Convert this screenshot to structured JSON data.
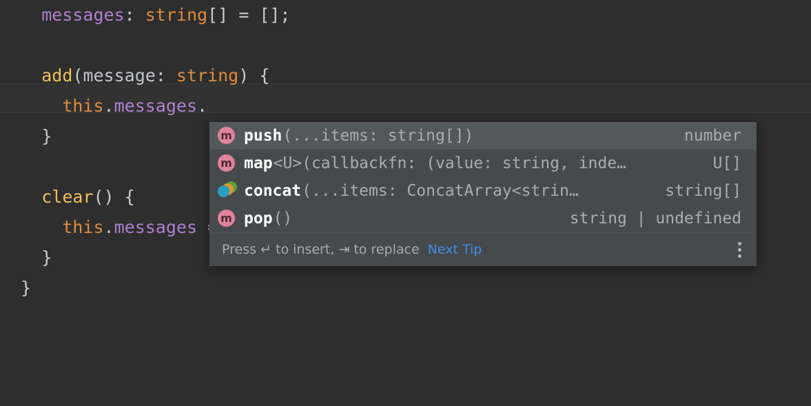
{
  "editor": {
    "background": "#2e2e2e",
    "current_line_highlight": "#323232",
    "lines": [
      {
        "indent": "    ",
        "tokens": [
          {
            "text": "messages",
            "kind": "property"
          },
          {
            "text": ": ",
            "kind": "punct"
          },
          {
            "text": "string",
            "kind": "type"
          },
          {
            "text": "[] = [];",
            "kind": "punct"
          }
        ]
      },
      {
        "indent": "",
        "tokens": []
      },
      {
        "indent": "    ",
        "tokens": [
          {
            "text": "add",
            "kind": "func"
          },
          {
            "text": "(",
            "kind": "punct"
          },
          {
            "text": "message",
            "kind": "param"
          },
          {
            "text": ": ",
            "kind": "punct"
          },
          {
            "text": "string",
            "kind": "type"
          },
          {
            "text": ") {",
            "kind": "punct"
          }
        ]
      },
      {
        "indent": "      ",
        "tokens": [
          {
            "text": "this",
            "kind": "keyword"
          },
          {
            "text": ".",
            "kind": "punct"
          },
          {
            "text": "messages",
            "kind": "property"
          },
          {
            "text": ".",
            "kind": "punct"
          }
        ]
      },
      {
        "indent": "    ",
        "tokens": [
          {
            "text": "}",
            "kind": "punct"
          }
        ]
      },
      {
        "indent": "",
        "tokens": []
      },
      {
        "indent": "    ",
        "tokens": [
          {
            "text": "clear",
            "kind": "func"
          },
          {
            "text": "() {",
            "kind": "punct"
          }
        ]
      },
      {
        "indent": "      ",
        "tokens": [
          {
            "text": "this",
            "kind": "keyword"
          },
          {
            "text": ".",
            "kind": "punct"
          },
          {
            "text": "messages",
            "kind": "property"
          },
          {
            "text": " = [];",
            "kind": "punct"
          }
        ]
      },
      {
        "indent": "    ",
        "tokens": [
          {
            "text": "}",
            "kind": "punct"
          }
        ]
      },
      {
        "indent": "  ",
        "tokens": [
          {
            "text": "}",
            "kind": "punct"
          }
        ]
      }
    ],
    "raw_lines": [
      "    messages: string[] = [];",
      "",
      "    add(message: string) {",
      "      this.messages.",
      "    }",
      "",
      "    clear() {",
      "      this.messages = [];",
      "    }",
      "  }"
    ]
  },
  "completion_popup": {
    "background": "#464a4d",
    "selected_background": "#53585b",
    "items": [
      {
        "icon": "method-icon",
        "name": "push",
        "signature": "(...items: string[])",
        "type": "number",
        "selected": true
      },
      {
        "icon": "method-icon",
        "name": "map",
        "signature": "<U>(callbackfn: (value: string, inde…",
        "type": "U[]",
        "selected": false
      },
      {
        "icon": "overloaded-members-icon",
        "name": "concat",
        "signature": "(...items: ConcatArray<strin…",
        "type": "string[]",
        "selected": false
      },
      {
        "icon": "method-icon",
        "name": "pop",
        "signature": "()",
        "type": "string | undefined",
        "selected": false
      }
    ],
    "footer": {
      "hint": "Press ↵ to insert, ⇥ to replace",
      "link": "Next Tip",
      "menu_icon": "kebab-menu-icon"
    }
  }
}
